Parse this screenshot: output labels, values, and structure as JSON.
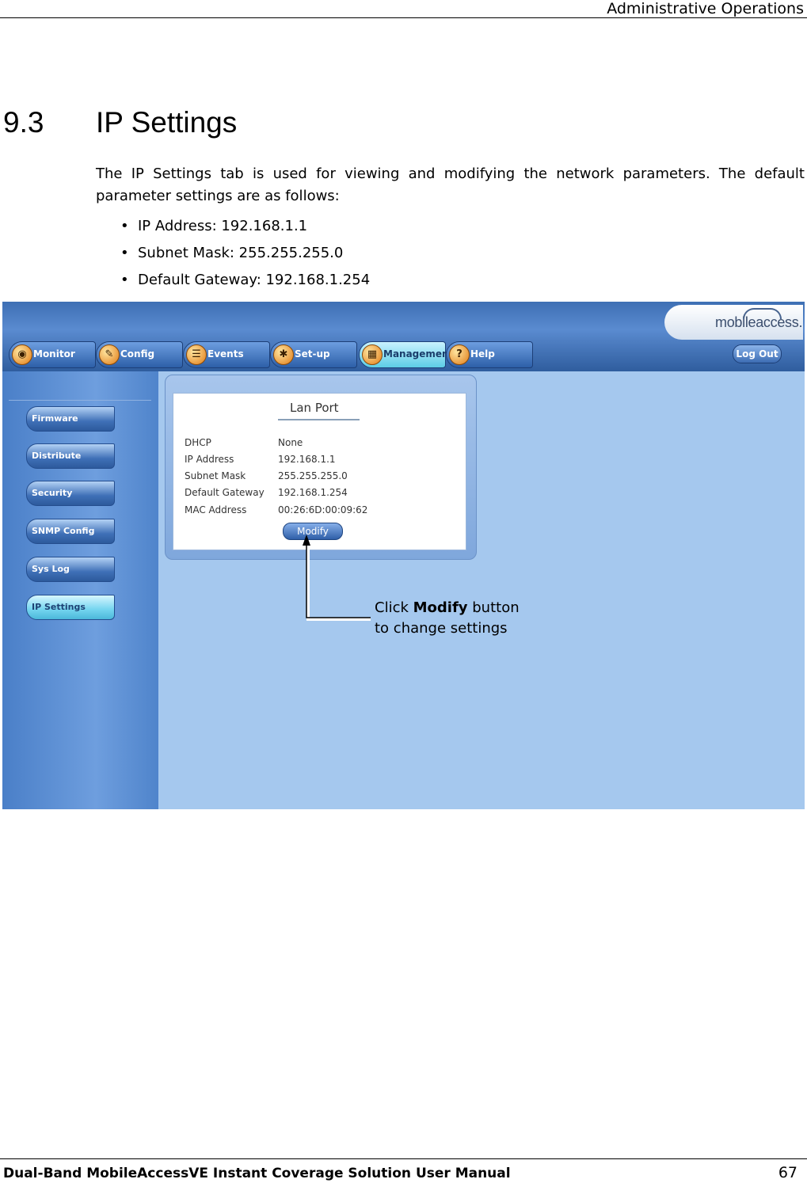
{
  "header": {
    "running_title": "Administrative Operations"
  },
  "section": {
    "number": "9.3",
    "title": "IP Settings",
    "intro": "The IP Settings tab is used for viewing and modifying the network parameters. The default parameter settings are as follows:",
    "bullets": [
      "IP Address: 192.168.1.1",
      "Subnet Mask: 255.255.255.0",
      "Default Gateway: 192.168.1.254"
    ]
  },
  "screenshot": {
    "brand": "mobileaccess.",
    "tabs": [
      {
        "label": "Monitor",
        "icon": "monitor-icon",
        "active": false
      },
      {
        "label": "Config",
        "icon": "wrench-icon",
        "active": false
      },
      {
        "label": "Events",
        "icon": "events-icon",
        "active": false
      },
      {
        "label": "Set-up",
        "icon": "tools-icon",
        "active": false
      },
      {
        "label": "Management",
        "icon": "management-icon",
        "active": true
      },
      {
        "label": "Help",
        "icon": "help-icon",
        "active": false
      }
    ],
    "logout_label": "Log Out",
    "sidebar_items": [
      {
        "label": "Firmware",
        "active": false
      },
      {
        "label": "Distribute",
        "active": false
      },
      {
        "label": "Security",
        "active": false
      },
      {
        "label": "SNMP Config",
        "active": false
      },
      {
        "label": "Sys Log",
        "active": false
      },
      {
        "label": "IP Settings",
        "active": true
      }
    ],
    "lan_port": {
      "title": "Lan Port",
      "rows": [
        {
          "label": "DHCP",
          "value": "None"
        },
        {
          "label": "IP Address",
          "value": "192.168.1.1"
        },
        {
          "label": "Subnet Mask",
          "value": "255.255.255.0"
        },
        {
          "label": "Default Gateway",
          "value": "192.168.1.254"
        },
        {
          "label": "MAC Address",
          "value": "00:26:6D:00:09:62"
        }
      ],
      "modify_label": "Modify"
    },
    "callout": {
      "prefix": "Click ",
      "bold": "Modify",
      "suffix": " button",
      "line2": "to change settings"
    }
  },
  "footer": {
    "manual_title": "Dual-Band MobileAccessVE Instant Coverage Solution User Manual",
    "page_number": "67"
  }
}
